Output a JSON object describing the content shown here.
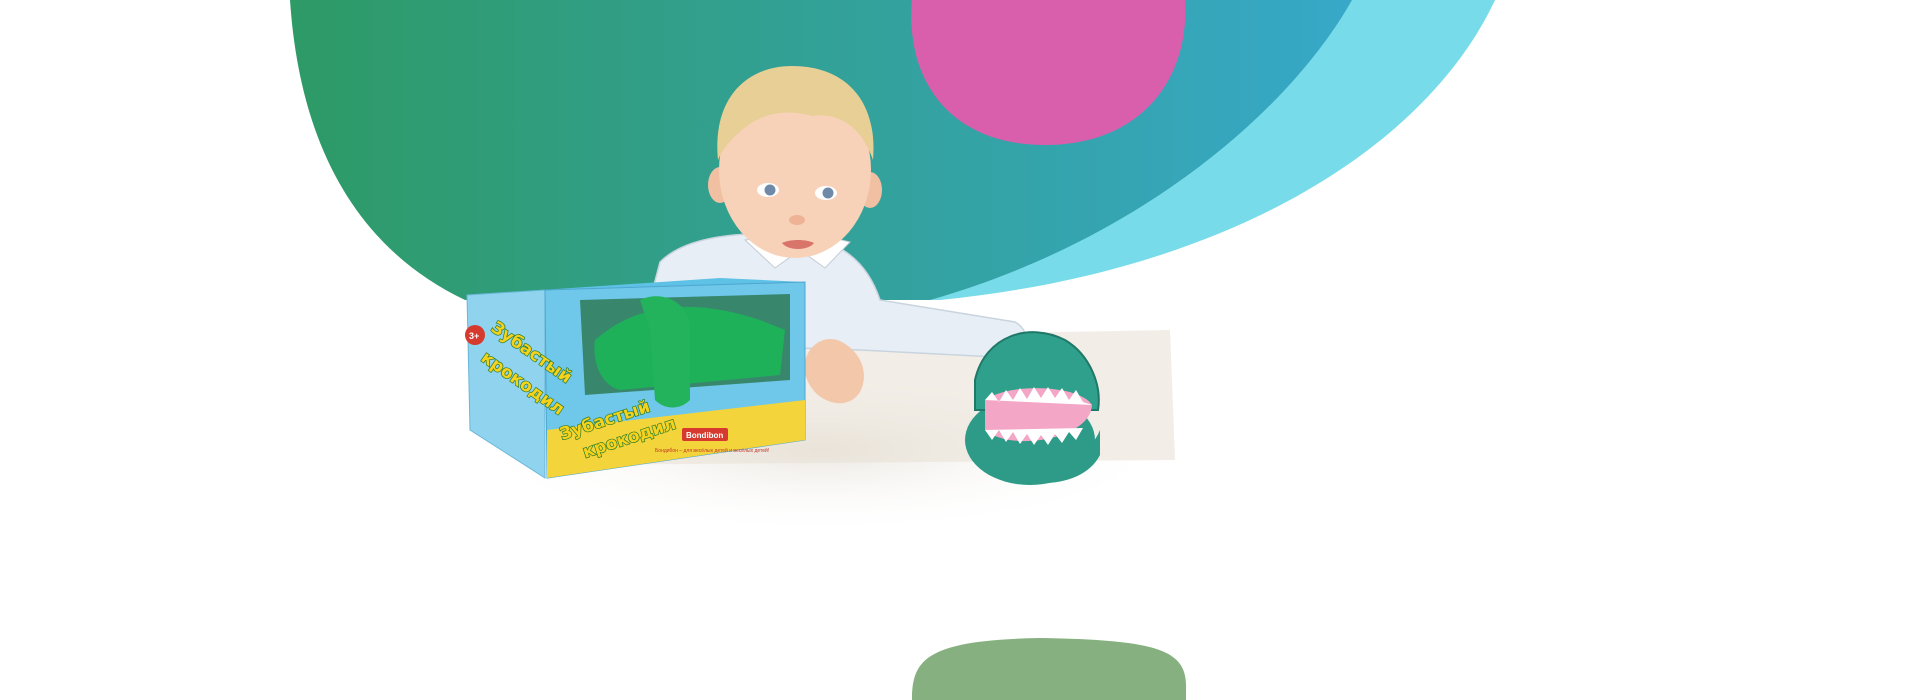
{
  "theme": {
    "gradient_start": "#2e9a66",
    "gradient_end": "#37a8c8",
    "cyan": "#78dbe9",
    "pink": "#d95fad",
    "sage": "#86b07f"
  },
  "hero": {
    "product": {
      "title_line1": "Зубастый",
      "title_line2": "крокодил",
      "brand": "Bondibon",
      "tagline": "Бондибон – для весёлых детей и весёлых детей!",
      "age_badge": "3+"
    }
  }
}
